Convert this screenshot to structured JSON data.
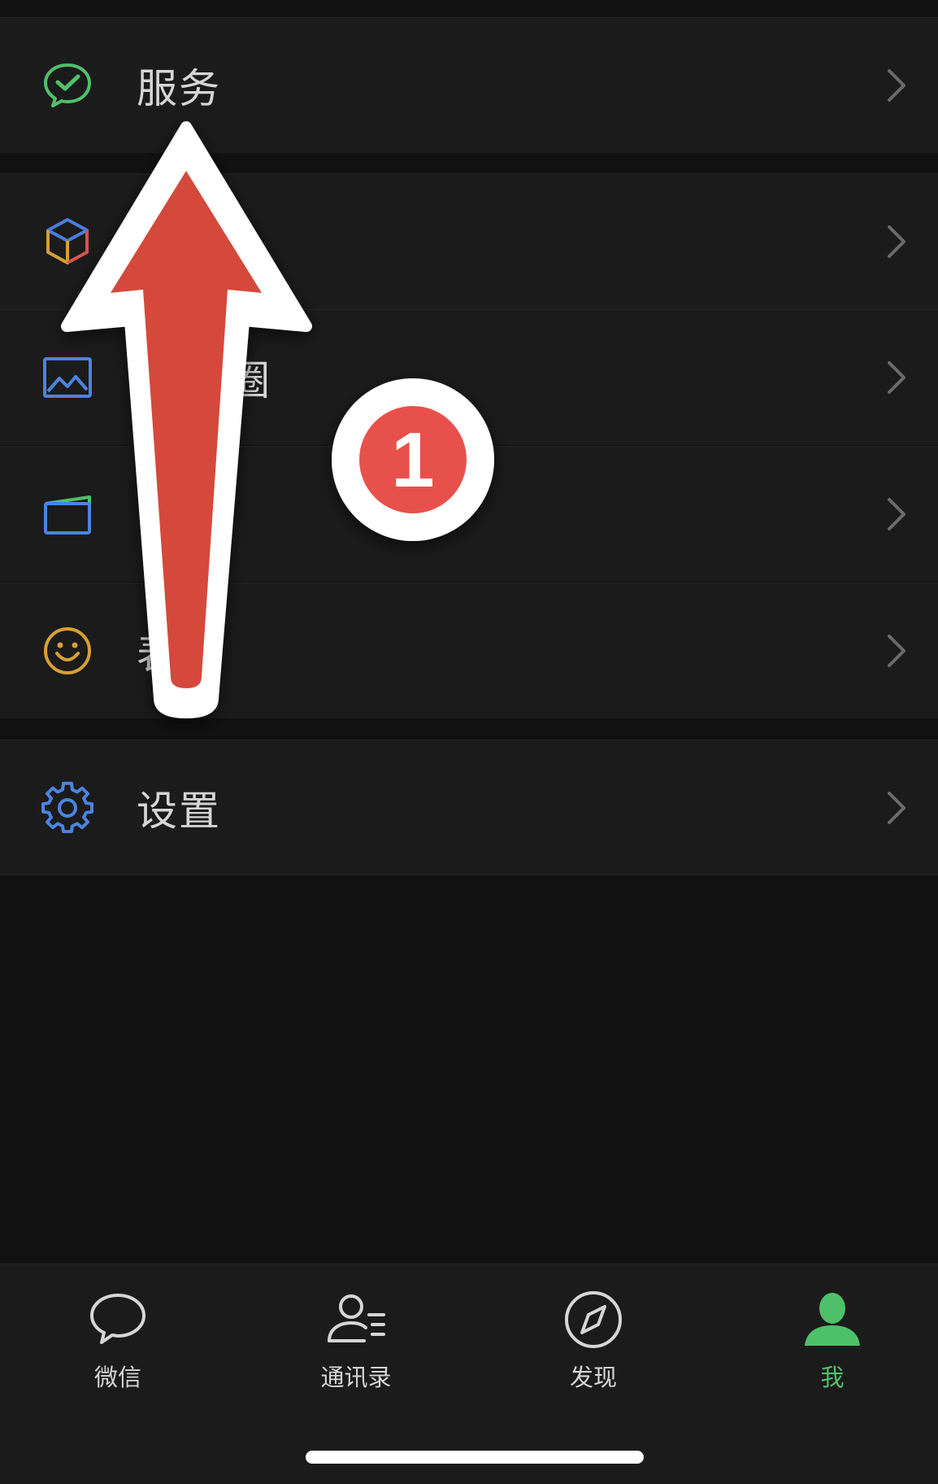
{
  "menu": {
    "items": [
      {
        "label": "服务",
        "icon": "wechat-pay-icon",
        "color": "#4fc06a"
      },
      {
        "label": "",
        "icon": "cube-icon",
        "color": "#4a7fd6"
      },
      {
        "label": "圈",
        "icon": "image-icon",
        "color": "#4a84e0"
      },
      {
        "label": "",
        "icon": "card-icon",
        "color": "#4a84e0"
      },
      {
        "label": "表",
        "icon": "smiley-icon",
        "color": "#d6a034"
      },
      {
        "label": "设置",
        "icon": "gear-icon",
        "color": "#4a84e0"
      }
    ]
  },
  "tabbar": {
    "tabs": [
      {
        "label": "微信",
        "icon": "chat-bubble-icon"
      },
      {
        "label": "通讯录",
        "icon": "contacts-icon"
      },
      {
        "label": "发现",
        "icon": "compass-icon"
      },
      {
        "label": "我",
        "icon": "person-icon",
        "active": true
      }
    ],
    "active_color": "#4fc06a"
  },
  "annotation": {
    "step_number": "1",
    "arrow_color": "#d44a3a",
    "badge_color": "#e8514b"
  }
}
